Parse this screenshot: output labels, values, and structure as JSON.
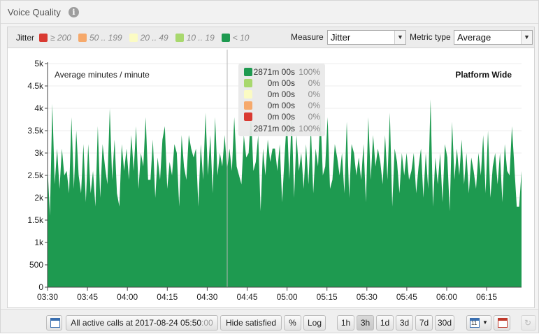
{
  "header": {
    "title": "Voice Quality",
    "info_icon": "info-icon"
  },
  "legend": {
    "label": "Jitter",
    "items": [
      {
        "label": "≥ 200",
        "color": "#d93a32"
      },
      {
        "label": "50 .. 199",
        "color": "#f6a96b"
      },
      {
        "label": "20 .. 49",
        "color": "#fbfbc3"
      },
      {
        "label": "10 .. 19",
        "color": "#a8d86e"
      },
      {
        "label": "< 10",
        "color": "#1e9a50"
      }
    ]
  },
  "controls": {
    "measure_label": "Measure",
    "measure_value": "Jitter",
    "metric_label": "Metric type",
    "metric_value": "Average"
  },
  "chart_data": {
    "type": "area",
    "ylim": [
      0,
      5000
    ],
    "y_ticks": [
      "0",
      "500",
      "1k",
      "1.5k",
      "2k",
      "2.5k",
      "3k",
      "3.5k",
      "4k",
      "4.5k",
      "5k"
    ],
    "x_ticks": [
      "03:30",
      "03:45",
      "04:00",
      "04:15",
      "04:30",
      "04:45",
      "05:00",
      "05:15",
      "05:30",
      "05:45",
      "06:00",
      "06:15"
    ],
    "annotation_left": "Average minutes / minute",
    "annotation_right": "Platform Wide",
    "fill_color": "#1e9a50",
    "cursor_time": "05:50",
    "values": [
      2700,
      1600,
      4100,
      2300,
      3100,
      2200,
      3100,
      2500,
      2600,
      2100,
      3800,
      2200,
      3500,
      2500,
      2100,
      3200,
      1900,
      3200,
      2100,
      2600,
      1800,
      3600,
      2000,
      3200,
      2700,
      2300,
      4000,
      2400,
      3300,
      2100,
      1800,
      3200,
      2600,
      3100,
      2400,
      3400,
      2600,
      3600,
      2200,
      3000,
      2700,
      3800,
      2400,
      2400,
      3300,
      2000,
      2900,
      2400,
      3300,
      3600,
      2200,
      2800,
      2500,
      3200,
      3000,
      1800,
      3400,
      2700,
      2400,
      3400,
      3100,
      2900,
      3100,
      1800,
      3200,
      2400,
      3900,
      2500,
      3400,
      2100,
      3800,
      2500,
      3000,
      2700,
      3400,
      2600,
      3100,
      2600,
      3800,
      2700,
      2500,
      2300,
      3400,
      2900,
      3000,
      3900,
      2600,
      2800,
      3400,
      1700,
      3100,
      2500,
      3300,
      2800,
      3100,
      3100,
      2600,
      3200,
      1900,
      2900,
      3800,
      2400,
      3900,
      2000,
      3400,
      2600,
      3000,
      2200,
      3200,
      2300,
      3600,
      2100,
      3100,
      2700,
      3900,
      2500,
      2700,
      3800,
      2200,
      2400,
      3200,
      2900,
      2500,
      3000,
      2100,
      3700,
      2000,
      3200,
      3000,
      2500,
      2900,
      2400,
      3200,
      1900,
      3800,
      2400,
      3400,
      2700,
      3100,
      2800,
      2300,
      3400,
      2400,
      3900,
      1800,
      3100,
      2800,
      2100,
      3000,
      2500,
      3000,
      2400,
      2600,
      3000,
      2100,
      2700,
      3100,
      2000,
      3000,
      2200,
      4200,
      1800,
      2900,
      2300,
      3000,
      1900,
      3200,
      2900,
      1700,
      3700,
      2400,
      3100,
      2500,
      3300,
      2300,
      3000,
      2100,
      2900,
      2600,
      2200,
      3000,
      2500,
      3400,
      2100,
      3500,
      2000,
      2700,
      3000,
      2300,
      3000,
      1900,
      3200,
      2600,
      2500,
      3600,
      2700,
      1800,
      1800,
      2600
    ]
  },
  "tooltip": {
    "rows": [
      {
        "color": "#1e9a50",
        "duration": "2871m 00s",
        "percent": "100%"
      },
      {
        "color": "#a8d86e",
        "duration": "0m 00s",
        "percent": "0%"
      },
      {
        "color": "#fbfbc3",
        "duration": "0m 00s",
        "percent": "0%"
      },
      {
        "color": "#f6a96b",
        "duration": "0m 00s",
        "percent": "0%"
      },
      {
        "color": "#d93a32",
        "duration": "0m 00s",
        "percent": "0%"
      }
    ],
    "total_duration": "2871m 00s",
    "total_percent": "100%"
  },
  "bottom": {
    "active_calls_prefix": "All active calls at 2017-08-24 05:50",
    "active_calls_suffix": ":00",
    "hide_satisfied": "Hide satisfied",
    "percent": "%",
    "log": "Log",
    "ranges": [
      "1h",
      "3h",
      "1d",
      "3d",
      "7d",
      "30d"
    ],
    "active_range": "3h",
    "calendar_day": "11"
  }
}
